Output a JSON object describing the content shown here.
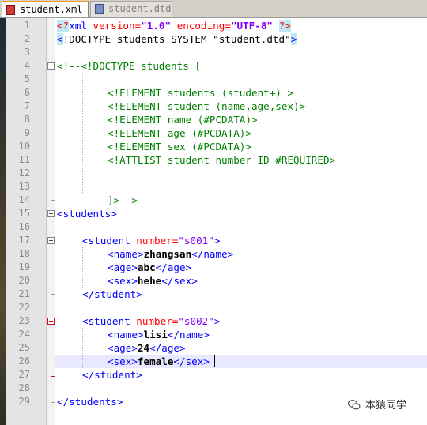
{
  "tabs": [
    {
      "label": "student.xml",
      "active": true,
      "icon": "xml-file-icon"
    },
    {
      "label": "student.dtd",
      "active": false,
      "icon": "dtd-file-icon"
    }
  ],
  "lines": [
    {
      "num": "1",
      "c": [
        "<?",
        "xml ",
        "version=",
        "\"1.0\" ",
        "encoding=",
        "\"UTF-8\" ",
        "?>"
      ]
    },
    {
      "num": "2",
      "c": [
        "<",
        "!DOCTYPE students SYSTEM \"student.dtd\"",
        ">"
      ]
    },
    {
      "num": "3"
    },
    {
      "num": "4",
      "c": [
        "<!--<!DOCTYPE students ["
      ]
    },
    {
      "num": "5"
    },
    {
      "num": "6",
      "c": [
        "<!ELEMENT students (student+) >"
      ]
    },
    {
      "num": "7",
      "c": [
        "<!ELEMENT student (name,age,sex)>"
      ]
    },
    {
      "num": "8",
      "c": [
        "<!ELEMENT name (#PCDATA)>"
      ]
    },
    {
      "num": "9",
      "c": [
        "<!ELEMENT age (#PCDATA)>"
      ]
    },
    {
      "num": "10",
      "c": [
        "<!ELEMENT sex (#PCDATA)>"
      ]
    },
    {
      "num": "11",
      "c": [
        "<!ATTLIST student number ID #REQUIRED>"
      ]
    },
    {
      "num": "12"
    },
    {
      "num": "13"
    },
    {
      "num": "14",
      "c": [
        "]>-->"
      ]
    },
    {
      "num": "15",
      "c": [
        "<students>"
      ]
    },
    {
      "num": "16"
    },
    {
      "num": "17",
      "c": [
        "<student ",
        "number=",
        "\"s001\"",
        ">"
      ]
    },
    {
      "num": "18",
      "c": [
        "<name>",
        "zhangsan",
        "</name>"
      ]
    },
    {
      "num": "19",
      "c": [
        "<age>",
        "abc",
        "</age>"
      ]
    },
    {
      "num": "20",
      "c": [
        "<sex>",
        "hehe",
        "</sex>"
      ]
    },
    {
      "num": "21",
      "c": [
        "</student>"
      ]
    },
    {
      "num": "22"
    },
    {
      "num": "23",
      "c": [
        "<student ",
        "number=",
        "\"s002\"",
        ">"
      ]
    },
    {
      "num": "24",
      "c": [
        "<name>",
        "lisi",
        "</name>"
      ]
    },
    {
      "num": "25",
      "c": [
        "<age>",
        "24",
        "</age>"
      ]
    },
    {
      "num": "26",
      "c": [
        "<sex>",
        "female",
        "</sex>"
      ]
    },
    {
      "num": "27",
      "c": [
        "</student>"
      ]
    },
    {
      "num": "28"
    },
    {
      "num": "29",
      "c": [
        "</students>"
      ]
    }
  ],
  "watermark": {
    "text": "本猿同学",
    "icon": "wechat-logo-icon"
  },
  "colors": {
    "tag": "#0000ff",
    "attribute": "#ff0000",
    "value": "#8000ff",
    "comment": "#008000",
    "current_line": "#e8e8ff",
    "active_tab_accent": "#f59a23"
  }
}
